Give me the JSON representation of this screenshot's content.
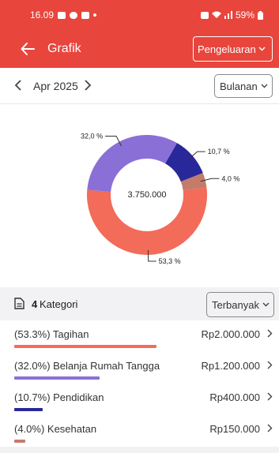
{
  "status_bar": {
    "time": "16.09",
    "battery": "59%"
  },
  "app_bar": {
    "title": "Grafik",
    "type_selected": "Pengeluaran"
  },
  "period": {
    "label": "Apr 2025",
    "mode_selected": "Bulanan"
  },
  "chart_data": {
    "type": "pie",
    "center_label": "3.750.000",
    "slices": [
      {
        "label": "53,3 %",
        "value": 53.3,
        "color": "#f36b59"
      },
      {
        "label": "32,0 %",
        "value": 32.0,
        "color": "#8a70d6"
      },
      {
        "label": "10,7 %",
        "value": 10.7,
        "color": "#29289a"
      },
      {
        "label": "4,0 %",
        "value": 4.0,
        "color": "#c47c6a"
      }
    ]
  },
  "categories_header": {
    "count": "4",
    "word": "Kategori",
    "sort_selected": "Terbanyak"
  },
  "categories": [
    {
      "name": "(53.3%) Tagihan",
      "amount": "Rp2.000.000",
      "share": 53.3,
      "color": "#f36b59"
    },
    {
      "name": "(32.0%) Belanja Rumah Tangga",
      "amount": "Rp1.200.000",
      "share": 32.0,
      "color": "#8a70d6"
    },
    {
      "name": "(10.7%) Pendidikan",
      "amount": "Rp400.000",
      "share": 10.7,
      "color": "#29289a"
    },
    {
      "name": "(4.0%) Kesehatan",
      "amount": "Rp150.000",
      "share": 4.0,
      "color": "#c47c6a"
    }
  ]
}
